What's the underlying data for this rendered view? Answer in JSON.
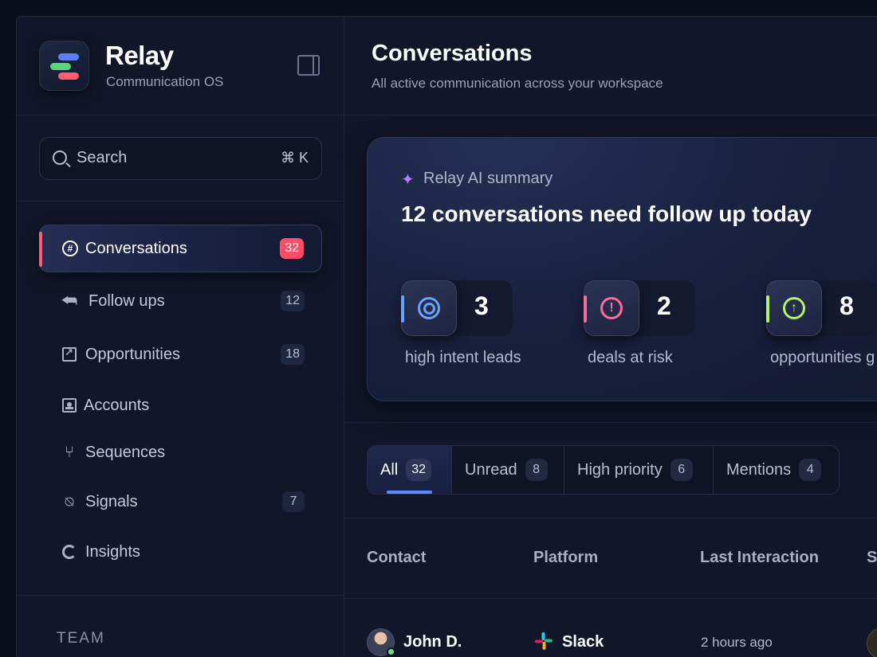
{
  "brand": {
    "name": "Relay",
    "subtitle": "Communication OS"
  },
  "search": {
    "label": "Search",
    "shortcut": "⌘ K"
  },
  "nav": {
    "items": [
      {
        "label": "Conversations",
        "badge": "32",
        "icon": "chat-hash-icon",
        "active": true
      },
      {
        "label": "Follow ups",
        "badge": "12",
        "icon": "reply-icon"
      },
      {
        "label": "Opportunities",
        "badge": "18",
        "icon": "arrow-up-right-box-icon"
      },
      {
        "label": "Accounts",
        "badge": "",
        "icon": "contact-card-icon"
      },
      {
        "label": "Sequences",
        "badge": "",
        "icon": "branch-icon"
      },
      {
        "label": "Signals",
        "badge": "7",
        "icon": "signal-icon"
      },
      {
        "label": "Insights",
        "badge": "",
        "icon": "pie-ring-icon"
      }
    ],
    "team_label": "TEAM"
  },
  "page": {
    "title": "Conversations",
    "subtitle": "All active communication across your workspace"
  },
  "ai_summary": {
    "kicker": "Relay AI summary",
    "headline": "12 conversations need follow up today",
    "stats": [
      {
        "value": "3",
        "label": "high intent leads",
        "icon": "target-icon",
        "color": "#6aa1ff"
      },
      {
        "value": "2",
        "label": "deals at risk",
        "icon": "alert-icon",
        "color": "#ff6b9a"
      },
      {
        "value": "8",
        "label": "opportunities g",
        "icon": "arrow-up-circle-icon",
        "color": "#b6f06a"
      }
    ]
  },
  "tabs": [
    {
      "label": "All",
      "count": "32",
      "active": true
    },
    {
      "label": "Unread",
      "count": "8"
    },
    {
      "label": "High priority",
      "count": "6"
    },
    {
      "label": "Mentions",
      "count": "4"
    }
  ],
  "table": {
    "columns": [
      "Contact",
      "Platform",
      "Last Interaction",
      "S"
    ],
    "rows": [
      {
        "contact": "John D.",
        "platform": "Slack",
        "last_interaction": "2 hours ago"
      }
    ]
  },
  "colors": {
    "accent": "#5b8cff",
    "active_badge": "#ff4d66",
    "online": "#6fe07a"
  }
}
